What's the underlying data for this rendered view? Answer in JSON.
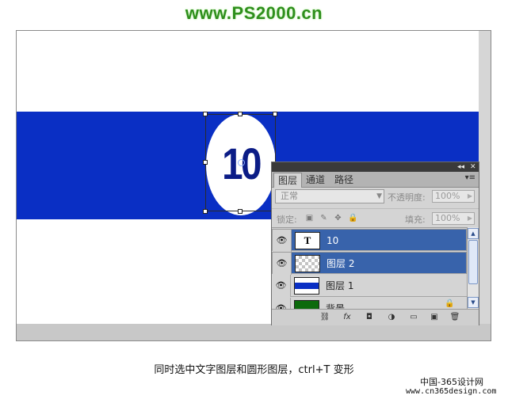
{
  "watermark_top": "www.PS2000.cn",
  "canvas": {
    "badge_number": "10",
    "colors": {
      "band": "#0a2fc4",
      "number": "#0b1c86",
      "ellipse": "#ffffff"
    }
  },
  "layers_panel": {
    "title_buttons": {
      "collapse": "◂◂",
      "close": "✕"
    },
    "tabs": [
      {
        "label": "图层",
        "active": true
      },
      {
        "label": "通道",
        "active": false
      },
      {
        "label": "路径",
        "active": false
      }
    ],
    "menu_icon": "▾≡",
    "blend_mode": "正常",
    "opacity_label": "不透明度:",
    "opacity_value": "100%",
    "lock_label": "锁定:",
    "fill_label": "填充:",
    "fill_value": "100%",
    "layers": [
      {
        "name": "10",
        "type": "text",
        "thumb_glyph": "T",
        "selected": true
      },
      {
        "name": "图层 2",
        "type": "transparent",
        "selected": true
      },
      {
        "name": "图层 1",
        "type": "band",
        "selected": false
      },
      {
        "name": "背景",
        "type": "background",
        "selected": false
      }
    ],
    "bottom_icons": [
      "link-icon",
      "fx-icon",
      "mask-icon",
      "adjustment-icon",
      "folder-icon",
      "new-layer-icon",
      "trash-icon"
    ],
    "bottom_labels": {
      "link": "⛓",
      "fx": "fx",
      "mask": "◘",
      "adjust": "◑",
      "folder": "▭",
      "new": "▣",
      "trash": "🗑"
    }
  },
  "caption": "同时选中文字图层和圆形图层，ctrl+T 变形",
  "watermark_br": {
    "line1": "中国-365设计网",
    "line2": "www.cn365design.com"
  }
}
